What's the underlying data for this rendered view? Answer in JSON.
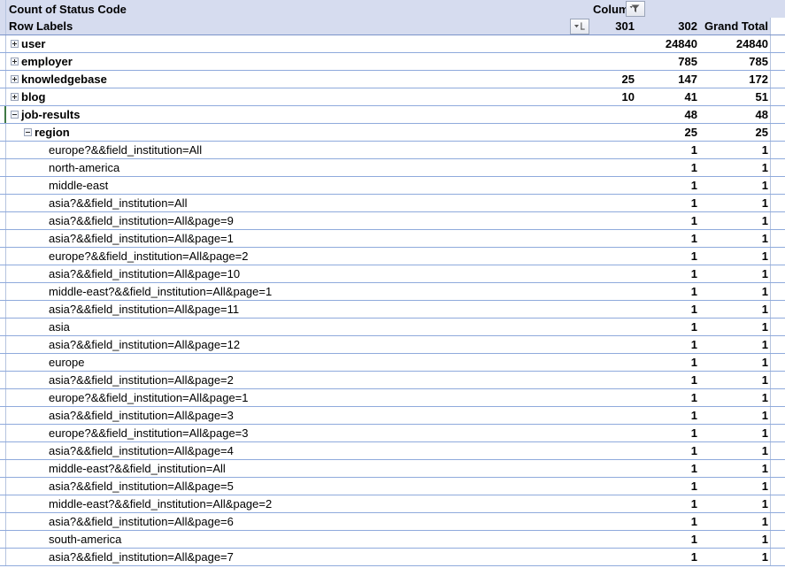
{
  "pivot": {
    "title": "Count of Status Code",
    "column_header_label": "Column",
    "row_header_label": "Row Labels",
    "column_headers": [
      "301",
      "302",
      "Grand Total"
    ],
    "icons": {
      "column_filter": "funnel-filter-icon",
      "row_filter": "sort-filter-icon",
      "expand": "plus-box-icon",
      "collapse": "minus-box-icon"
    },
    "colors": {
      "header_background": "#d6dcef",
      "grid_line": "#8faadc",
      "selection_marker": "#3f7844",
      "border": "#b6c4df"
    },
    "rows": [
      {
        "label": "user",
        "level": 0,
        "state": "collapsed",
        "c301": "",
        "c302": "24840",
        "total": "24840"
      },
      {
        "label": "employer",
        "level": 0,
        "state": "collapsed",
        "c301": "",
        "c302": "785",
        "total": "785"
      },
      {
        "label": "knowledgebase",
        "level": 0,
        "state": "collapsed",
        "c301": "25",
        "c302": "147",
        "total": "172"
      },
      {
        "label": "blog",
        "level": 0,
        "state": "collapsed",
        "c301": "10",
        "c302": "41",
        "total": "51"
      },
      {
        "label": "job-results",
        "level": 0,
        "state": "expanded",
        "c301": "",
        "c302": "48",
        "total": "48",
        "marked": true
      },
      {
        "label": "region",
        "level": 1,
        "state": "expanded",
        "c301": "",
        "c302": "25",
        "total": "25"
      },
      {
        "label": "europe?&&field_institution=All",
        "level": 2,
        "state": "leaf",
        "c301": "",
        "c302": "1",
        "total": "1"
      },
      {
        "label": "north-america",
        "level": 2,
        "state": "leaf",
        "c301": "",
        "c302": "1",
        "total": "1"
      },
      {
        "label": "middle-east",
        "level": 2,
        "state": "leaf",
        "c301": "",
        "c302": "1",
        "total": "1"
      },
      {
        "label": "asia?&&field_institution=All",
        "level": 2,
        "state": "leaf",
        "c301": "",
        "c302": "1",
        "total": "1"
      },
      {
        "label": "asia?&&field_institution=All&page=9",
        "level": 2,
        "state": "leaf",
        "c301": "",
        "c302": "1",
        "total": "1"
      },
      {
        "label": "asia?&&field_institution=All&page=1",
        "level": 2,
        "state": "leaf",
        "c301": "",
        "c302": "1",
        "total": "1"
      },
      {
        "label": "europe?&&field_institution=All&page=2",
        "level": 2,
        "state": "leaf",
        "c301": "",
        "c302": "1",
        "total": "1"
      },
      {
        "label": "asia?&&field_institution=All&page=10",
        "level": 2,
        "state": "leaf",
        "c301": "",
        "c302": "1",
        "total": "1"
      },
      {
        "label": "middle-east?&&field_institution=All&page=1",
        "level": 2,
        "state": "leaf",
        "c301": "",
        "c302": "1",
        "total": "1"
      },
      {
        "label": "asia?&&field_institution=All&page=11",
        "level": 2,
        "state": "leaf",
        "c301": "",
        "c302": "1",
        "total": "1"
      },
      {
        "label": "asia",
        "level": 2,
        "state": "leaf",
        "c301": "",
        "c302": "1",
        "total": "1"
      },
      {
        "label": "asia?&&field_institution=All&page=12",
        "level": 2,
        "state": "leaf",
        "c301": "",
        "c302": "1",
        "total": "1"
      },
      {
        "label": "europe",
        "level": 2,
        "state": "leaf",
        "c301": "",
        "c302": "1",
        "total": "1"
      },
      {
        "label": "asia?&&field_institution=All&page=2",
        "level": 2,
        "state": "leaf",
        "c301": "",
        "c302": "1",
        "total": "1"
      },
      {
        "label": "europe?&&field_institution=All&page=1",
        "level": 2,
        "state": "leaf",
        "c301": "",
        "c302": "1",
        "total": "1"
      },
      {
        "label": "asia?&&field_institution=All&page=3",
        "level": 2,
        "state": "leaf",
        "c301": "",
        "c302": "1",
        "total": "1"
      },
      {
        "label": "europe?&&field_institution=All&page=3",
        "level": 2,
        "state": "leaf",
        "c301": "",
        "c302": "1",
        "total": "1"
      },
      {
        "label": "asia?&&field_institution=All&page=4",
        "level": 2,
        "state": "leaf",
        "c301": "",
        "c302": "1",
        "total": "1"
      },
      {
        "label": "middle-east?&&field_institution=All",
        "level": 2,
        "state": "leaf",
        "c301": "",
        "c302": "1",
        "total": "1"
      },
      {
        "label": "asia?&&field_institution=All&page=5",
        "level": 2,
        "state": "leaf",
        "c301": "",
        "c302": "1",
        "total": "1"
      },
      {
        "label": "middle-east?&&field_institution=All&page=2",
        "level": 2,
        "state": "leaf",
        "c301": "",
        "c302": "1",
        "total": "1"
      },
      {
        "label": "asia?&&field_institution=All&page=6",
        "level": 2,
        "state": "leaf",
        "c301": "",
        "c302": "1",
        "total": "1"
      },
      {
        "label": "south-america",
        "level": 2,
        "state": "leaf",
        "c301": "",
        "c302": "1",
        "total": "1"
      },
      {
        "label": "asia?&&field_institution=All&page=7",
        "level": 2,
        "state": "leaf",
        "c301": "",
        "c302": "1",
        "total": "1"
      }
    ]
  }
}
